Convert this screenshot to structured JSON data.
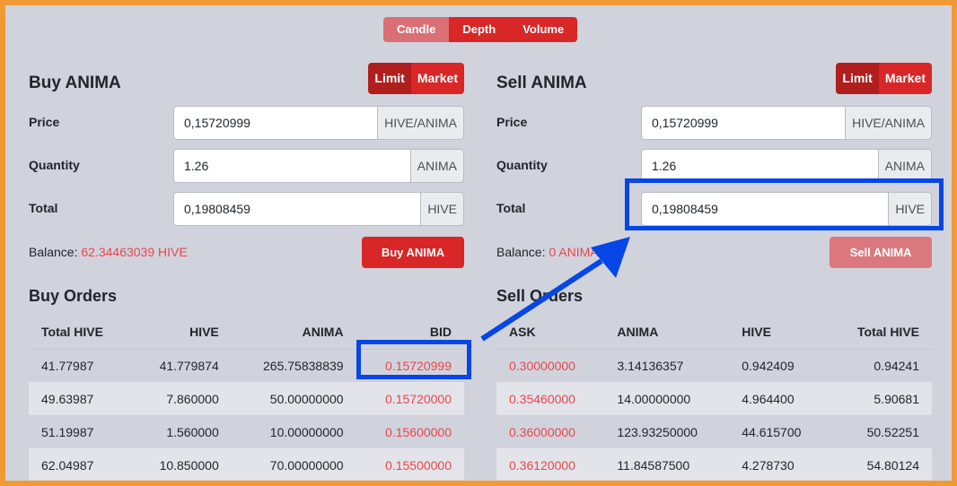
{
  "chart_toggle": [
    "Candle",
    "Depth",
    "Volume"
  ],
  "buy": {
    "title": "Buy ANIMA",
    "type_toggle": {
      "limit": "Limit",
      "market": "Market"
    },
    "price": {
      "label": "Price",
      "value": "0,15720999",
      "unit": "HIVE/ANIMA"
    },
    "quantity": {
      "label": "Quantity",
      "value": "1.26",
      "unit": "ANIMA"
    },
    "total": {
      "label": "Total",
      "value": "0,19808459",
      "unit": "HIVE"
    },
    "balance_label": "Balance:",
    "balance_value": "62.34463039 HIVE",
    "button": "Buy ANIMA",
    "orders_title": "Buy Orders",
    "columns": [
      "Total HIVE",
      "HIVE",
      "ANIMA",
      "BID"
    ],
    "rows": [
      [
        "41.77987",
        "41.779874",
        "265.75838839",
        "0.15720999"
      ],
      [
        "49.63987",
        "7.860000",
        "50.00000000",
        "0.15720000"
      ],
      [
        "51.19987",
        "1.560000",
        "10.00000000",
        "0.15600000"
      ],
      [
        "62.04987",
        "10.850000",
        "70.00000000",
        "0.15500000"
      ]
    ]
  },
  "sell": {
    "title": "Sell ANIMA",
    "type_toggle": {
      "limit": "Limit",
      "market": "Market"
    },
    "price": {
      "label": "Price",
      "value": "0,15720999",
      "unit": "HIVE/ANIMA"
    },
    "quantity": {
      "label": "Quantity",
      "value": "1.26",
      "unit": "ANIMA"
    },
    "total": {
      "label": "Total",
      "value": "0,19808459",
      "unit": "HIVE"
    },
    "balance_label": "Balance:",
    "balance_value": "0 ANIMA",
    "button": "Sell ANIMA",
    "orders_title": "Sell Orders",
    "columns": [
      "ASK",
      "ANIMA",
      "HIVE",
      "Total HIVE"
    ],
    "rows": [
      [
        "0.30000000",
        "3.14136357",
        "0.942409",
        "0.94241"
      ],
      [
        "0.35460000",
        "14.00000000",
        "4.964400",
        "5.90681"
      ],
      [
        "0.36000000",
        "123.93250000",
        "44.615700",
        "50.52251"
      ],
      [
        "0.36120000",
        "11.84587500",
        "4.278730",
        "54.80124"
      ]
    ]
  },
  "colors": {
    "accent": "#d92626",
    "highlight": "#0645e6",
    "frame": "#f09a37",
    "negative": "#e8474c"
  }
}
